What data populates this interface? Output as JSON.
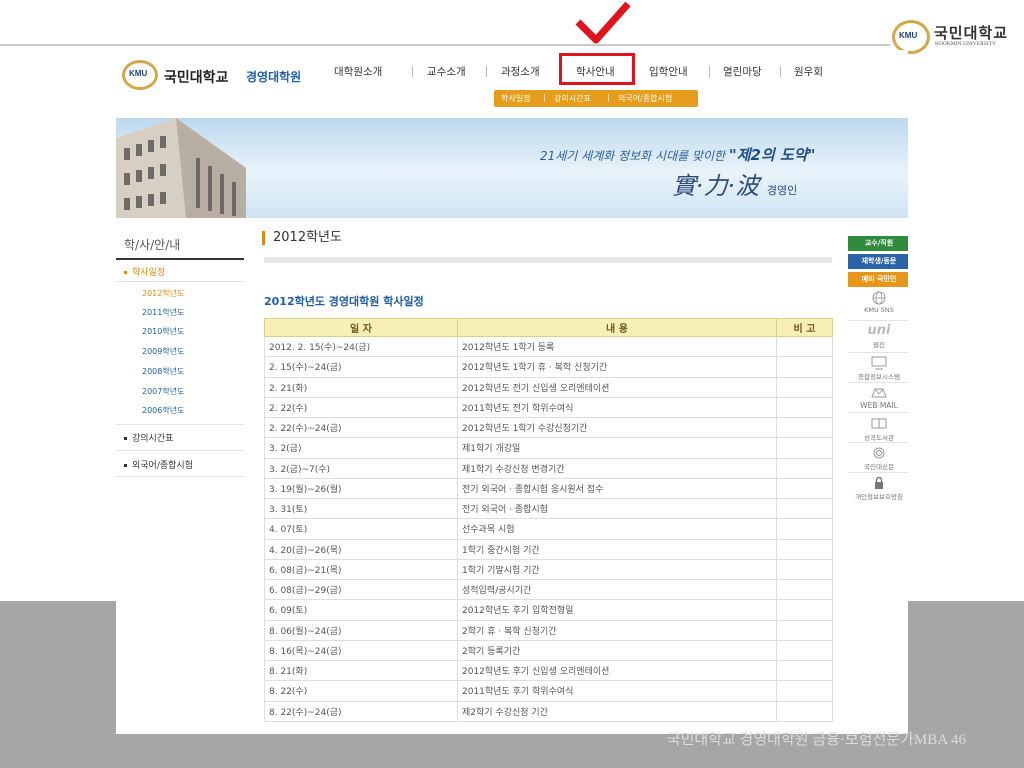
{
  "slide": {
    "footer_text": "국민대학교 경영대학원 금융·보험전문가MBA 46",
    "corner_logo": {
      "emblem": "KMU",
      "name": "국민대학교",
      "english": "KOOKMIN UNIVERSITY"
    },
    "checkmark_color": "#e0141e"
  },
  "site": {
    "logo": {
      "emblem": "KMU",
      "university": "국민대학교",
      "school": "경영대학원"
    },
    "gnb": [
      "대학원소개",
      "교수소개",
      "과정소개",
      "학사안내",
      "입학안내",
      "열린마당",
      "원우회"
    ],
    "gnb_active": "학사안내",
    "subnav": [
      "학사일정",
      "강의시간표",
      "외국어/종합시험"
    ],
    "banner": {
      "slogan_prefix": "21세기 세계화 정보화 시대를 맞이한",
      "slogan_emph": "\"제2의 도약\"",
      "hanja": "實·力·波",
      "hanja_suffix": "경영인"
    },
    "lnb": {
      "title": "학/사/안/내",
      "items": [
        {
          "label": "학사일정",
          "active": true
        },
        {
          "label": "강의시간표",
          "active": false
        },
        {
          "label": "외국어/종합시험",
          "active": false
        }
      ],
      "years": [
        "2012학년도",
        "2011학년도",
        "2010학년도",
        "2009학년도",
        "2008학년도",
        "2007학년도",
        "2006학년도"
      ],
      "active_year": "2012학년도"
    },
    "content": {
      "page_title": "2012학년도",
      "table_title": "2012학년도 경영대학원 학사일정",
      "headers": [
        "일 자",
        "내 용",
        "비 고"
      ],
      "rows": [
        [
          "2012. 2. 15(수)~24(금)",
          "2012학년도 1학기 등록",
          ""
        ],
        [
          "2. 15(수)~24(금)",
          "2012학년도 1학기 휴 · 복학 신청기간",
          ""
        ],
        [
          "2. 21(화)",
          "2012학년도 전기 신입생 오리엔테이션",
          ""
        ],
        [
          "2. 22(수)",
          "2011학년도 전기 학위수여식",
          ""
        ],
        [
          "2. 22(수)~24(금)",
          "2012학년도 1학기 수강신청기간",
          ""
        ],
        [
          "3. 2(금)",
          "제1학기 개강일",
          ""
        ],
        [
          "3. 2(금)~7(수)",
          "제1학기 수강신청 변경기간",
          ""
        ],
        [
          "3. 19(월)~26(월)",
          "전기 외국어 · 종합시험 응시원서 접수",
          ""
        ],
        [
          "3. 31(토)",
          "전기 외국어 · 종합시험",
          ""
        ],
        [
          "4. 07(토)",
          "선수과목 시험",
          ""
        ],
        [
          "4. 20(금)~26(목)",
          "1학기 중간시험 기간",
          ""
        ],
        [
          "6. 08(금)~21(목)",
          "1학기 기말시험 기간",
          ""
        ],
        [
          "6. 08(금)~29(금)",
          "성적입력/공시기간",
          ""
        ],
        [
          "6. 09(토)",
          "2012학년도 후기 입학전형일",
          ""
        ],
        [
          "8. 06(월)~24(금)",
          "2학기 휴 · 복학 신청기간",
          ""
        ],
        [
          "8. 16(목)~24(금)",
          "2학기 등록기간",
          ""
        ],
        [
          "8. 21(화)",
          "2012학년도 후기 신입생 오리엔테이션",
          ""
        ],
        [
          "8. 22(수)",
          "2011학년도 후기 학위수여식",
          ""
        ],
        [
          "8. 22(수)~24(금)",
          "제2학기 수강신청 기간",
          ""
        ]
      ]
    },
    "quick": {
      "buttons": [
        {
          "label": "교수/직원",
          "color": "#2f8c3c"
        },
        {
          "label": "재학생/동문",
          "color": "#2a63a8"
        },
        {
          "label": "예비 국민인",
          "color": "#e7961c"
        }
      ],
      "links": [
        "KMU SNS",
        "웹진",
        "종합정보시스템",
        "WEB MAIL",
        "성곡도서관",
        "국민대신문",
        "개인정보보호방침"
      ],
      "uni_logo": "uni"
    }
  }
}
